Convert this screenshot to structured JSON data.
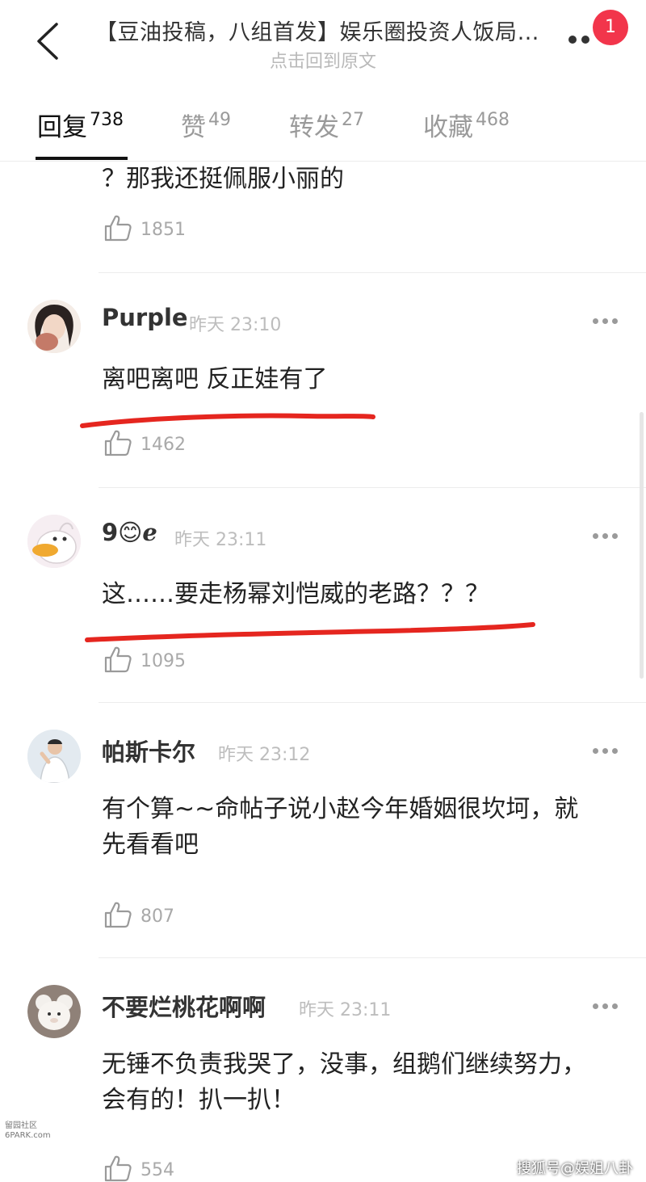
{
  "header": {
    "title": "【豆油投稿，八组首发】娱乐圈投资人饭局…",
    "subtitle": "点击回到原文",
    "notification_count": "1"
  },
  "tabs": [
    {
      "label": "回复",
      "count": "738",
      "active": true
    },
    {
      "label": "赞",
      "count": "49",
      "active": false
    },
    {
      "label": "转发",
      "count": "27",
      "active": false
    },
    {
      "label": "收藏",
      "count": "468",
      "active": false
    }
  ],
  "partial_comment": {
    "text": "？那我还挺佩服小丽的",
    "likes": "1851"
  },
  "comments": [
    {
      "user": "Purple",
      "time": "昨天 23:10",
      "text": "离吧离吧 反正娃有了",
      "likes": "1462",
      "underlined": true
    },
    {
      "user": "9😊ℯ",
      "time": "昨天 23:11",
      "text": "这……要走杨幂刘恺威的老路？？？",
      "likes": "1095",
      "underlined": true
    },
    {
      "user": "帕斯卡尔",
      "time": "昨天 23:12",
      "text": "有个算~~命帖子说小赵今年婚姻很坎坷，就先看看吧",
      "likes": "807",
      "underlined": false
    },
    {
      "user": "不要烂桃花啊啊",
      "time": "昨天 23:11",
      "text": "无锤不负责我哭了，没事，组鹅们继续努力，会有的！扒一扒！",
      "likes": "554",
      "underlined": false
    }
  ],
  "watermarks": {
    "left": "留园社区\n6PARK.com",
    "right": "搜狐号@娱姐八卦"
  },
  "colors": {
    "badge": "#f2354b",
    "annotation_red": "#e5261f",
    "text_primary": "#222222",
    "text_secondary": "#bdbdbd"
  }
}
